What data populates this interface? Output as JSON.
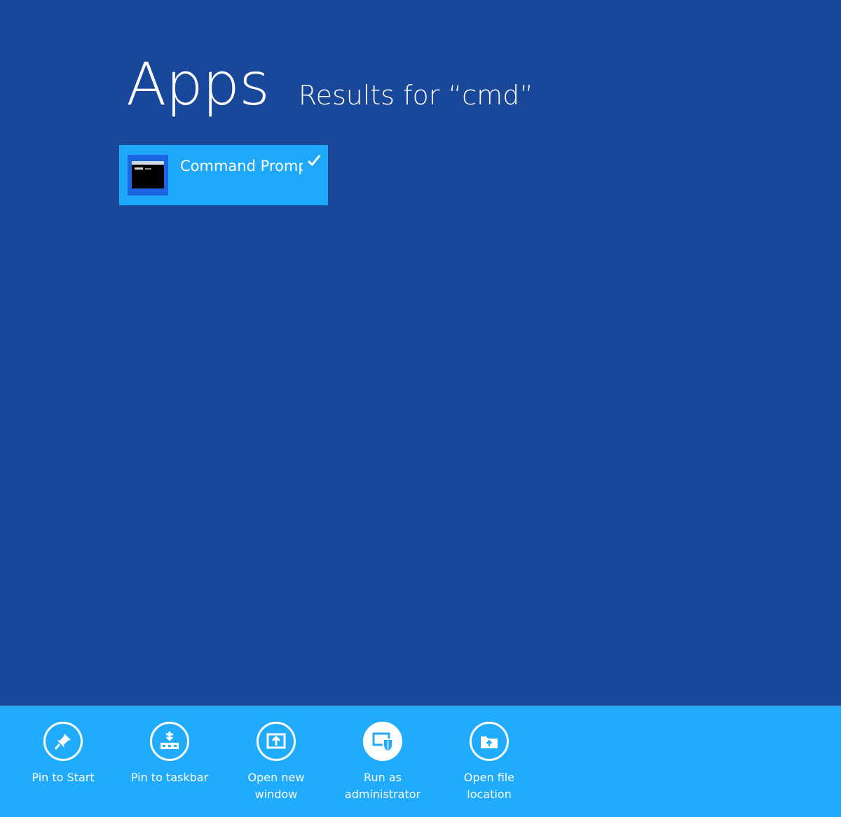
{
  "header": {
    "title": "Apps",
    "subtitle": "Results for “cmd”"
  },
  "results": [
    {
      "label": "Command Prompt",
      "icon": "command-prompt-icon",
      "selected": true
    }
  ],
  "app_bar": {
    "commands": [
      {
        "label": "Pin to Start",
        "icon": "pin-icon"
      },
      {
        "label": "Pin to taskbar",
        "icon": "taskbar-pin-icon"
      },
      {
        "label": "Open new\nwindow",
        "icon": "new-window-icon"
      },
      {
        "label": "Run as\nadministrator",
        "icon": "admin-shield-icon"
      },
      {
        "label": "Open file\nlocation",
        "icon": "folder-icon"
      }
    ]
  },
  "colors": {
    "background": "#19479a",
    "tile": "#1fa7f9",
    "app_bar": "#21abfc"
  }
}
